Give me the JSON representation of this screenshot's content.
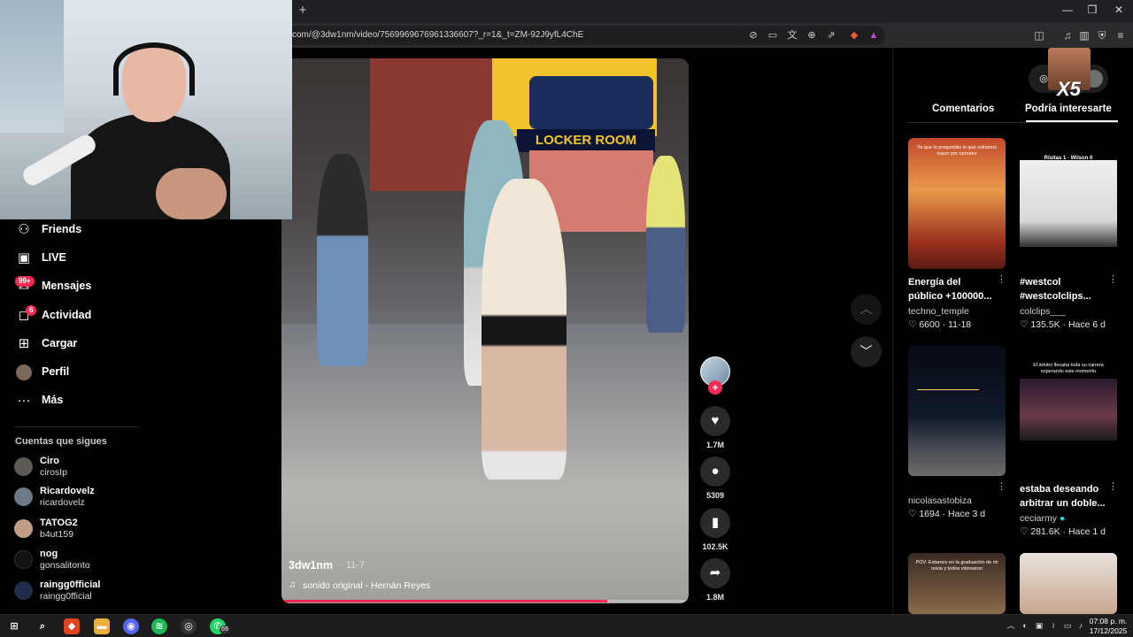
{
  "browser": {
    "new_tab": "+",
    "url": "com/@3dw1nm/video/7569969676961336607?_r=1&_t=ZM-92J9yfL4ChE",
    "win_minimize": "—",
    "win_restore": "❐",
    "win_close": "✕"
  },
  "sidebar": {
    "items": [
      {
        "label": "Friends",
        "icon": "friends-icon"
      },
      {
        "label": "LIVE",
        "icon": "live-icon"
      },
      {
        "label": "Mensajes",
        "icon": "messages-icon",
        "badge": "99+"
      },
      {
        "label": "Actividad",
        "icon": "activity-icon",
        "badge": "6"
      },
      {
        "label": "Cargar",
        "icon": "upload-icon"
      },
      {
        "label": "Perfil",
        "icon": "profile-icon"
      },
      {
        "label": "Más",
        "icon": "more-icon"
      }
    ],
    "following_title": "Cuentas que sigues",
    "following": [
      {
        "name": "Ciro",
        "user": "cirosIp"
      },
      {
        "name": "Ricardovelz",
        "user": "ricardovelz"
      },
      {
        "name": "TATOG2",
        "user": "b4ut159"
      },
      {
        "name": "nog",
        "user": "gonsalitonto"
      },
      {
        "name": "raingg0fficial",
        "user": "raingg0fficial"
      }
    ]
  },
  "video": {
    "sign": "LOCKER ROOM",
    "author": "3dw1nm",
    "date": "· 11-7",
    "sound_icon": "♫",
    "sound": "sonido original - Hernán Reyes",
    "progress": 0.8
  },
  "actions": {
    "follow": "+",
    "likes": "1.7M",
    "comments": "5309",
    "saves": "102.5K",
    "shares": "1.8M"
  },
  "right_panel": {
    "tab_comments": "Comentarios",
    "tab_recommended": "Podría interesarte",
    "overlay": "X5",
    "cards": [
      {
        "title": "Energía del público +100000...",
        "author": "techno_temple",
        "likes": "6600",
        "date": "11-18",
        "thumb_text": "Ya que lo preguntáis lo que solíamos hacer por rumores"
      },
      {
        "title": "#westcol #westcolclips...",
        "author": "colclips___",
        "likes": "135.5K",
        "date": "Hace 6 d",
        "thumb_text": "Risitas 1 · Wilson 0"
      },
      {
        "title": "",
        "author": "nicolasastobiza",
        "likes": "1694",
        "date": "Hace 3 d",
        "thumb_text": ""
      },
      {
        "title": "estaba deseando arbitrar un doble...",
        "author": "ceciarmy",
        "likes": "281.6K",
        "date": "Hace 1 d",
        "thumb_text": "El árbitro llevaba toda su carrera esperando este momento"
      },
      {
        "title": "",
        "author": "",
        "likes": "",
        "date": "",
        "thumb_text": "POV: Estamos en la graduación de mi novia y todos vitorearon"
      },
      {
        "title": "",
        "author": "",
        "likes": "",
        "date": "",
        "thumb_text": ""
      }
    ]
  },
  "taskbar": {
    "whatsapp_badge": "69",
    "time": "07:08 p. m.",
    "date": "17/12/2025"
  },
  "colors": {
    "accent": "#fe2c55",
    "background": "#000000"
  }
}
